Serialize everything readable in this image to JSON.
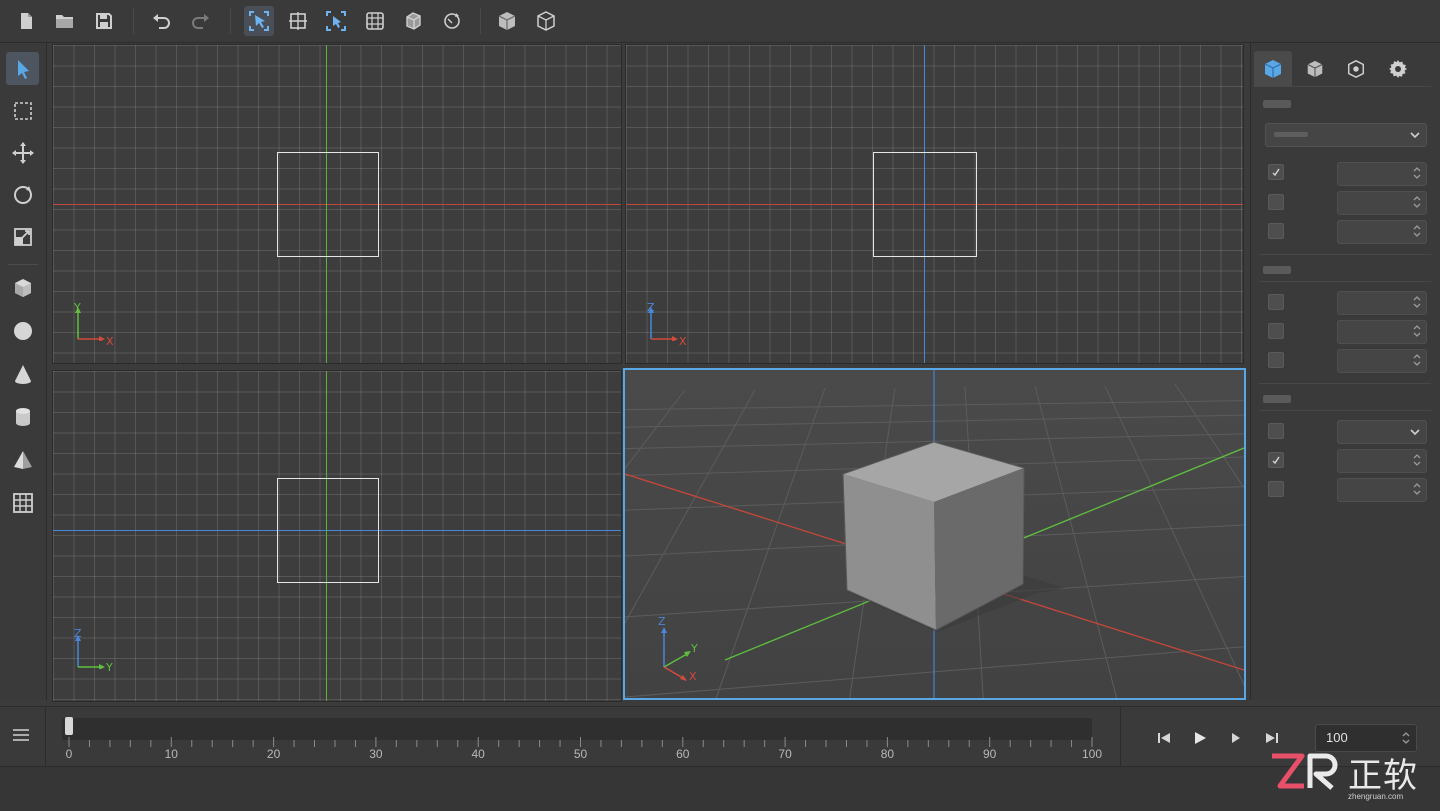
{
  "toolbar": {
    "icons": [
      "new-file-icon",
      "open-folder-icon",
      "save-icon",
      "undo-icon",
      "redo-icon",
      "select-mode-icon",
      "frame-selection-icon",
      "focus-icon",
      "wireframe-icon",
      "shaded-icon",
      "orbit-icon",
      "cube-solid-icon",
      "cube-outline-icon"
    ]
  },
  "left_tools": {
    "icons": [
      "select-cursor-icon",
      "marquee-select-icon",
      "move-icon",
      "rotate-icon",
      "scale-icon",
      "cube-icon",
      "sphere-icon",
      "cone-icon",
      "cylinder-icon",
      "pyramid-icon",
      "grid-plane-icon"
    ]
  },
  "viewports": {
    "top": {
      "axis_h": "X",
      "axis_v": "Y"
    },
    "front": {
      "axis_h": "X",
      "axis_v": "Z"
    },
    "side": {
      "axis_h": "Y",
      "axis_v": "Z"
    },
    "perspective": {
      "axis_x": "X",
      "axis_y": "Y",
      "axis_z": "Z"
    }
  },
  "right_panel": {
    "tabs": [
      "object-properties-icon",
      "mesh-icon",
      "material-icon",
      "settings-icon"
    ],
    "sections": [
      {
        "rows": [
          {
            "checked": true
          },
          {
            "checked": false
          },
          {
            "checked": false
          }
        ]
      },
      {
        "rows": [
          {
            "checked": false
          },
          {
            "checked": false
          },
          {
            "checked": false
          }
        ]
      },
      {
        "rows": [
          {
            "checked": false
          },
          {
            "checked": true
          },
          {
            "checked": false
          }
        ]
      }
    ]
  },
  "timeline": {
    "tick_labels": [
      "0",
      "10",
      "20",
      "30",
      "40",
      "50",
      "60",
      "70",
      "80",
      "90",
      "100"
    ],
    "current_frame": 0,
    "end_frame": "100",
    "menu_icon": "hamburger-icon",
    "playback_icons": [
      "skip-to-start-icon",
      "play-icon",
      "step-forward-icon",
      "skip-to-end-icon"
    ]
  },
  "watermark": {
    "logo_letters": "ZR",
    "text": "正软",
    "url": "zhengruan.com"
  },
  "colors": {
    "accent": "#5aa7e6",
    "axis_x": "#d24b3b",
    "axis_y": "#5fbf3f",
    "axis_z": "#4a86d9"
  }
}
